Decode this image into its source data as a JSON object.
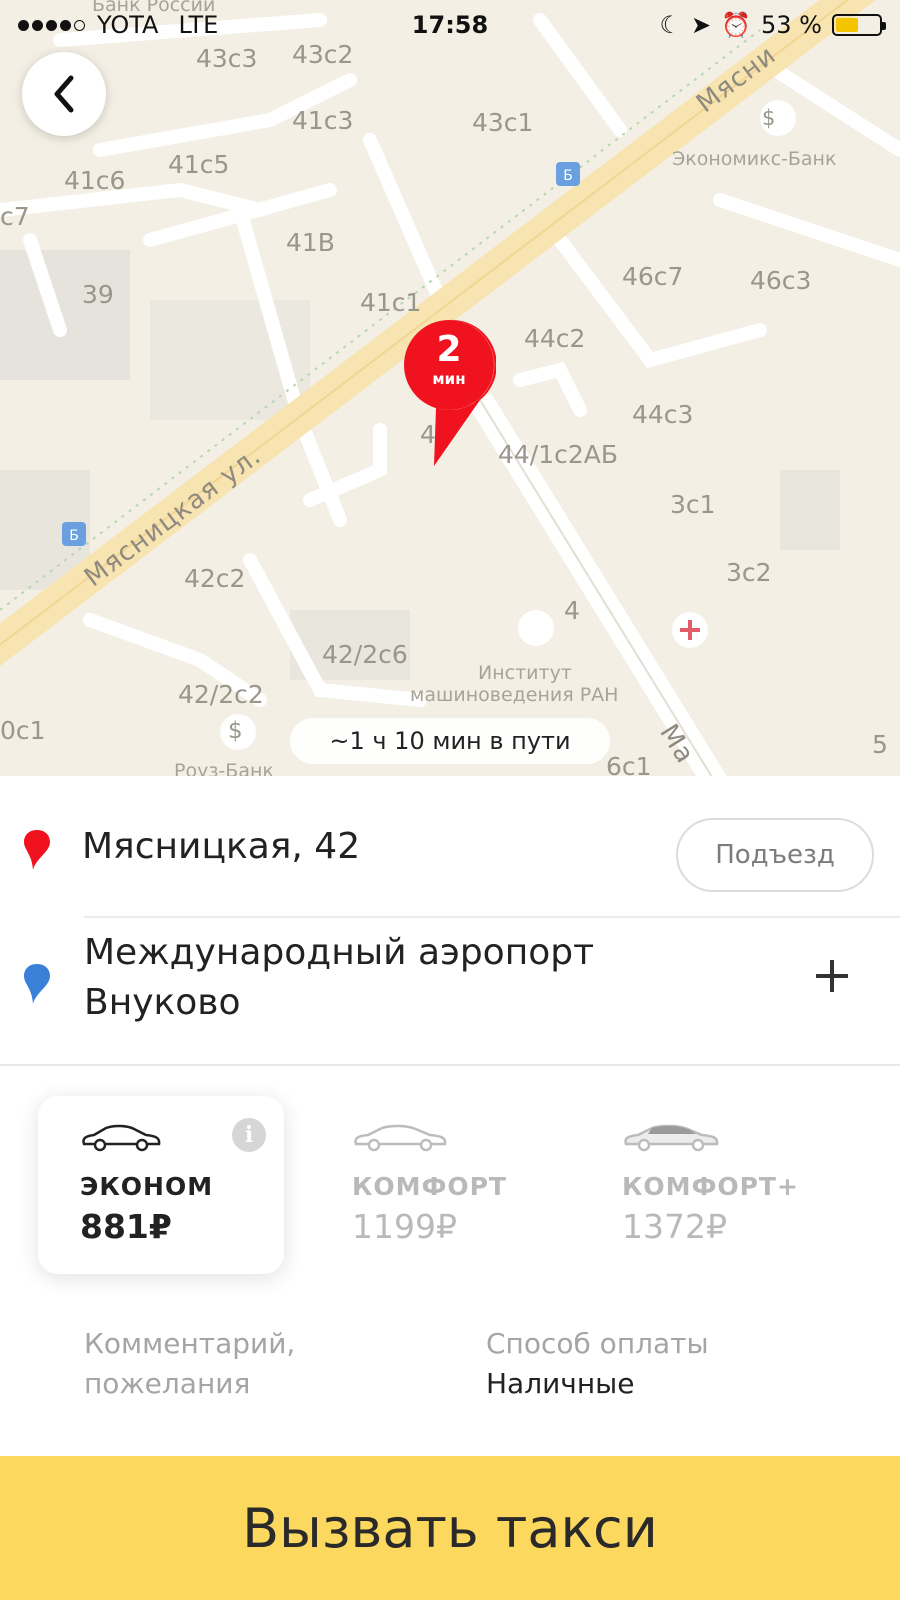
{
  "status_bar": {
    "carrier": "YOTA",
    "network": "LTE",
    "time": "17:58",
    "battery_percent": "53 %",
    "battery_level": 0.53
  },
  "map": {
    "buildings": [
      "43с3",
      "43с2",
      "41с3",
      "43с1",
      "41с6",
      "41с5",
      "с7",
      "41В",
      "39",
      "41с1",
      "46с7",
      "46с3",
      "44с2",
      "44с3",
      "42",
      "44/1с2АБ",
      "3с1",
      "3с2",
      "42с2",
      "4",
      "42/2с6",
      "42/2с2",
      "0с1",
      "6с1",
      "5"
    ],
    "street_main": "Мясницкая ул.",
    "street_main_top": "Мясни",
    "street_side": "Ма",
    "poi_bank": "Экономикс-Банк",
    "poi_top": "Банк России",
    "poi_institute_line1": "Институт",
    "poi_institute_line2": "машиноведения РАН",
    "poi_bottom": "Роуз-Банк"
  },
  "pickup_pin": {
    "minutes": "2",
    "unit": "мин"
  },
  "trip_duration": "~1 ч 10 мин в пути",
  "route": {
    "from": "Мясницкая, 42",
    "entrance_button": "Подъезд",
    "to": "Международный аэропорт Внуково"
  },
  "tariffs": [
    {
      "name": "ЭКОНОМ",
      "price": "881₽"
    },
    {
      "name": "КОМФОРТ",
      "price": "1199₽"
    },
    {
      "name": "КОМФОРТ+",
      "price": "1372₽"
    }
  ],
  "options": {
    "comment": "Комментарий, пожелания",
    "payment_label": "Способ оплаты",
    "payment_value": "Наличные"
  },
  "cta": "Вызвать такси",
  "colors": {
    "accent": "#fcd85e",
    "pin_red": "#f0131f",
    "destination_blue": "#3a7fd8"
  }
}
